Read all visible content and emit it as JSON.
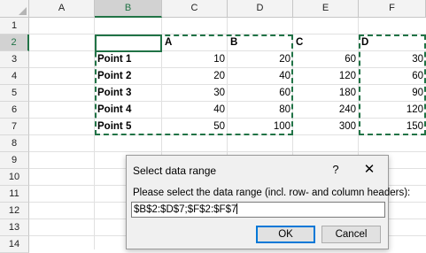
{
  "sheet": {
    "columns": [
      "A",
      "B",
      "C",
      "D",
      "E",
      "F"
    ],
    "rows": [
      "1",
      "2",
      "3",
      "4",
      "5",
      "6",
      "7",
      "8",
      "9",
      "10",
      "11",
      "12",
      "13",
      "14"
    ],
    "header_row": {
      "c": "A",
      "d": "B",
      "e": "C",
      "f": "D"
    },
    "data": [
      {
        "label": "Point 1",
        "c": "10",
        "d": "20",
        "e": "60",
        "f": "30"
      },
      {
        "label": "Point 2",
        "c": "20",
        "d": "40",
        "e": "120",
        "f": "60"
      },
      {
        "label": "Point 3",
        "c": "30",
        "d": "60",
        "e": "180",
        "f": "90"
      },
      {
        "label": "Point 4",
        "c": "40",
        "d": "80",
        "e": "240",
        "f": "120"
      },
      {
        "label": "Point 5",
        "c": "50",
        "d": "100",
        "e": "300",
        "f": "150"
      }
    ]
  },
  "dialog": {
    "title": "Select data range",
    "help": "?",
    "close": "✕",
    "prompt": "Please select the data range (incl. row- and column headers):",
    "range_value": "$B$2:$D$7;$F$2:$F$7",
    "ok_label": "OK",
    "cancel_label": "Cancel"
  },
  "colors": {
    "accent": "#217346",
    "default_button": "#0078d7"
  }
}
